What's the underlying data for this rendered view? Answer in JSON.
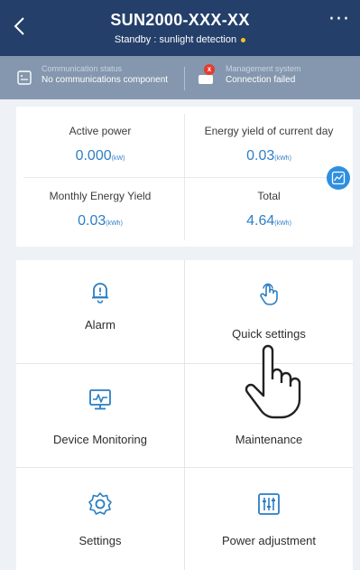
{
  "header": {
    "title": "SUN2000-XXX-XX",
    "subtitle": "Standby : sunlight detection",
    "back_icon": "chevron-left-icon",
    "more_icon": "more-icon",
    "more_label": "···"
  },
  "status": {
    "communication": {
      "label": "Communication status",
      "value": "No communications component",
      "icon": "router-icon"
    },
    "management": {
      "label": "Management system",
      "value": "Connection failed",
      "icon": "cloud-error-icon",
      "badge": "x"
    },
    "dot_color": "#f6c324"
  },
  "energy": {
    "active_power": {
      "label": "Active power",
      "value": "0.000",
      "unit": "(kW)"
    },
    "yield_today": {
      "label": "Energy yield of current day",
      "value": "0.03",
      "unit": "(kWh)"
    },
    "monthly_yield": {
      "label": "Monthly Energy Yield",
      "value": "0.03",
      "unit": "(kWh)"
    },
    "total": {
      "label": "Total",
      "value": "4.64",
      "unit": "(kWh)"
    }
  },
  "menu": {
    "alarm": {
      "label": "Alarm",
      "icon": "bell-icon"
    },
    "quick_settings": {
      "label": "Quick settings",
      "icon": "tap-icon"
    },
    "device_monitoring": {
      "label": "Device Monitoring",
      "icon": "monitor-icon"
    },
    "maintenance": {
      "label": "Maintenance",
      "icon": "wrench-icon"
    },
    "settings": {
      "label": "Settings",
      "icon": "gear-icon"
    },
    "power_adjustment": {
      "label": "Power adjustment",
      "icon": "sliders-icon"
    }
  },
  "colors": {
    "header_bg": "#243f6a",
    "status_bg": "#8497ae",
    "accent": "#2f7ec7",
    "icon": "#2a7dc2"
  }
}
